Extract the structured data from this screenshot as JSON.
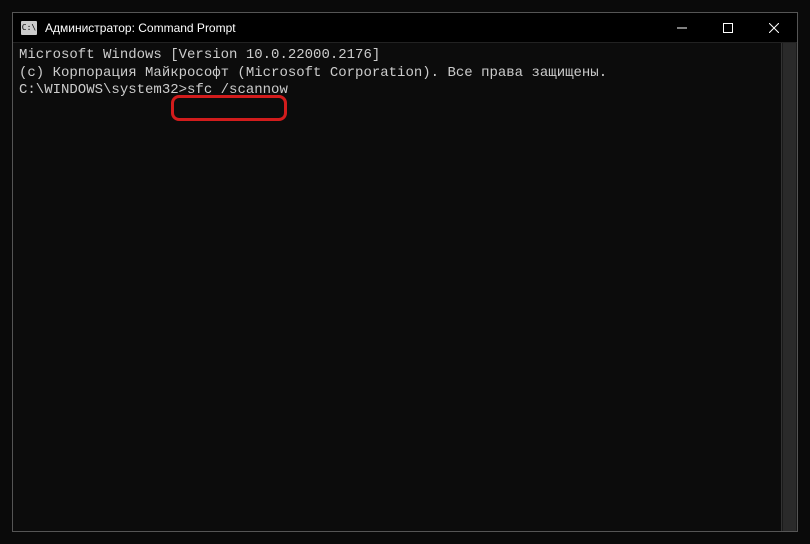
{
  "window": {
    "title": "Администратор: Command Prompt",
    "icon_label": "cmd-icon"
  },
  "terminal": {
    "lines": {
      "version": "Microsoft Windows [Version 10.0.22000.2176]",
      "copyright": "(c) Корпорация Майкрософт (Microsoft Corporation). Все права защищены.",
      "blank": "",
      "prompt": "C:\\WINDOWS\\system32>",
      "command": "sfc /scannow"
    }
  },
  "highlight": {
    "target": "sfc /scannow",
    "color": "#d21c1c"
  }
}
